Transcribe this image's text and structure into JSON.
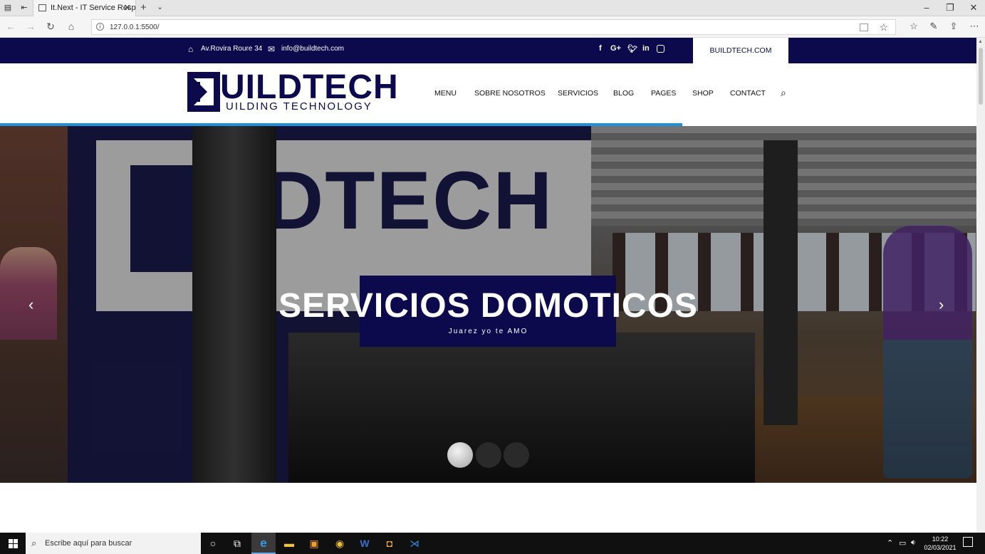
{
  "browser": {
    "tab_title": "It.Next - IT Service Resp",
    "url": "127.0.0.1:5500/",
    "icons": [
      "tab-list-icon",
      "tab-back-icon",
      "back-icon",
      "forward-icon",
      "refresh-icon",
      "home-icon",
      "info-icon",
      "reading-view-icon",
      "favorite-star-icon",
      "favorites-icon",
      "pen-icon",
      "share-icon",
      "more-icon"
    ]
  },
  "topbar": {
    "address": "Av.Rovira Roure 34",
    "email": "info@buildtech.com",
    "social": [
      "f",
      "G+",
      "twitter",
      "in",
      "instagram"
    ],
    "domain_label": "BUILDTECH.COM"
  },
  "logo": {
    "word": "UILDTECH",
    "tagline": "UILDING TECHNOLOGY"
  },
  "nav": {
    "items": [
      "MENU",
      "SOBRE NOSOTROS",
      "SERVICIOS",
      "BLOG",
      "PAGES",
      "SHOP",
      "CONTACT"
    ]
  },
  "hero": {
    "title": "SERVICIOS DOMOTICOS",
    "subtitle": "Juarez yo te AMO",
    "slides_count": 3,
    "active_slide": 1,
    "prev_arrow": "‹",
    "next_arrow": "›"
  },
  "taskbar": {
    "search_placeholder": "Escribe aquí para buscar",
    "time": "10:22",
    "date": "02/03/2021",
    "apps": [
      "cortana-icon",
      "task-view-icon",
      "edge-icon",
      "file-explorer-icon",
      "store-icon",
      "chrome-icon",
      "word-icon",
      "app-icon",
      "vscode-icon"
    ]
  },
  "colors": {
    "brand_navy": "#0c0a4c",
    "accent_blue": "#1e90d8"
  }
}
